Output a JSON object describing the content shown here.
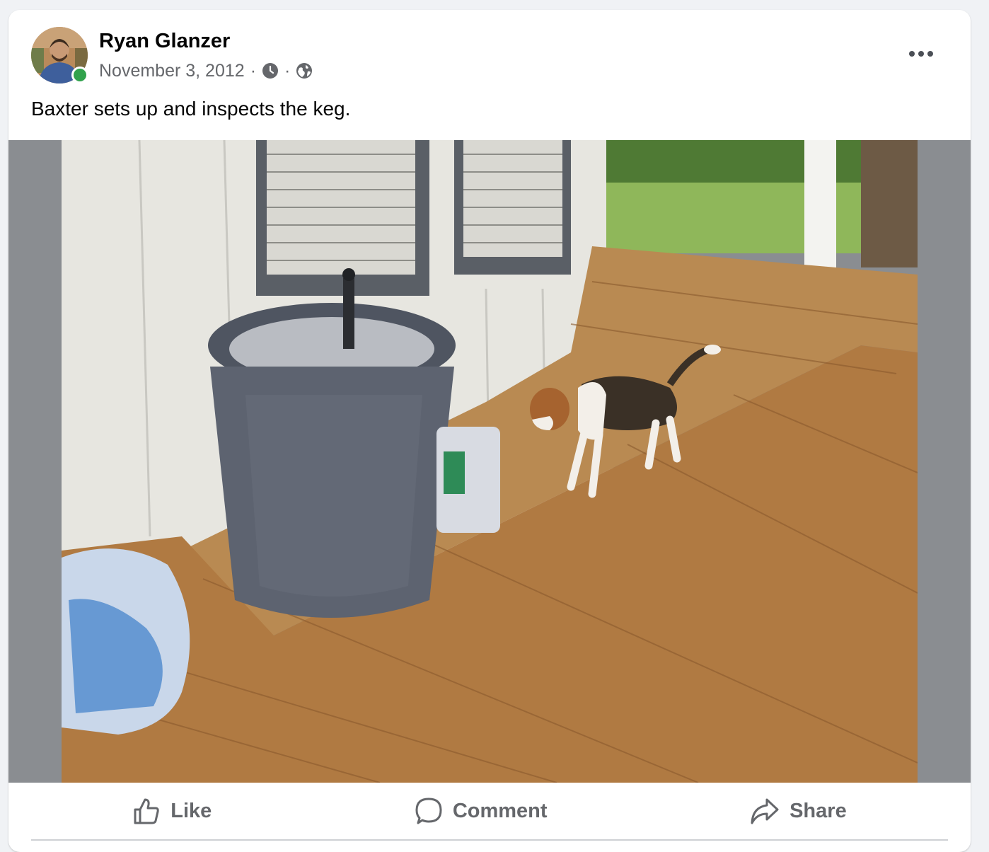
{
  "post": {
    "author": "Ryan Glanzer",
    "date": "November 3, 2012",
    "separator": "·",
    "caption": "Baxter sets up and inspects the keg.",
    "privacy_icon": "globe-icon",
    "time_icon": "clock-icon",
    "more_icon": "more-options-icon"
  },
  "actions": {
    "like_label": "Like",
    "comment_label": "Comment",
    "share_label": "Share"
  },
  "colors": {
    "text_primary": "#050505",
    "text_secondary": "#65676b",
    "online_status": "#31a24c",
    "photo_background": "#8a8d91"
  }
}
